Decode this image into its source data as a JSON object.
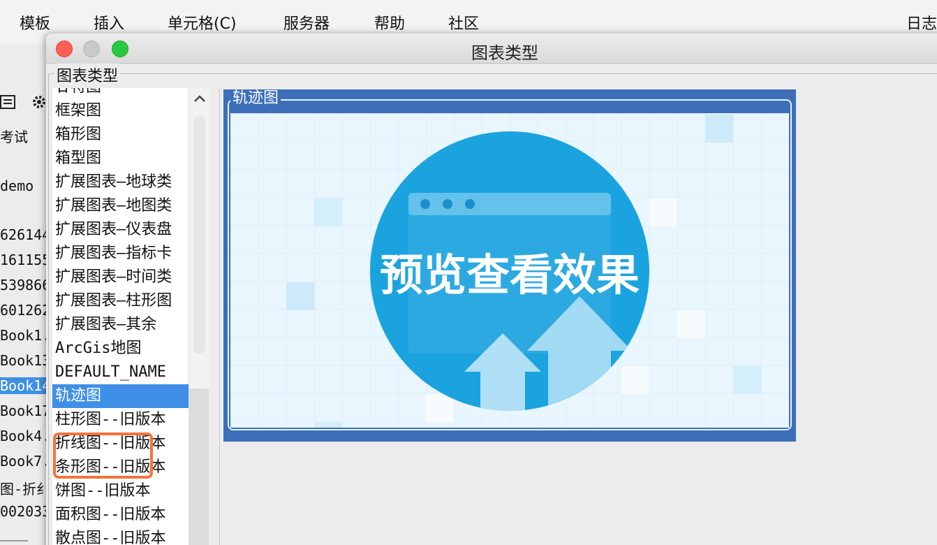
{
  "menubar": {
    "items": [
      "模板",
      "插入",
      "单元格(C)",
      "服务器",
      "帮助",
      "社区"
    ],
    "right_item": "日志"
  },
  "background_panel": {
    "items": [
      "考试",
      "demo",
      "626144",
      "161155",
      "539866",
      "601262",
      "Book1.",
      "Book13",
      "Book14",
      "Book17",
      "Book4.",
      "Book7.",
      "图-折纟",
      "002033"
    ],
    "selected_index": 8
  },
  "dialog": {
    "title": "图表类型",
    "group_label": "图表类型",
    "list_items": [
      "甘特图",
      "框架图",
      "箱形图",
      "箱型图",
      "扩展图表—地球类",
      "扩展图表—地图类",
      "扩展图表—仪表盘",
      "扩展图表—指标卡",
      "扩展图表—时间类",
      "扩展图表—柱形图",
      "扩展图表—其余",
      "ArcGis地图",
      "DEFAULT_NAME",
      "轨迹图",
      "柱形图--旧版本",
      "折线图--旧版本",
      "条形图--旧版本",
      "饼图--旧版本",
      "面积图--旧版本",
      "散点图--旧版本"
    ],
    "selected_index": 13,
    "preview": {
      "label": "轨迹图",
      "image_text": "预览查看效果"
    }
  },
  "colors": {
    "selection": "#3f8fe6",
    "highlight_box": "#f2733a",
    "preview_bg": "#3c6fb8",
    "circle": "#1aa3df"
  },
  "icons": {
    "close": "close-icon",
    "minimize": "minimize-icon",
    "maximize": "maximize-icon",
    "scroll_up": "chevron-up-icon",
    "upload": "upload-arrow-icon"
  }
}
